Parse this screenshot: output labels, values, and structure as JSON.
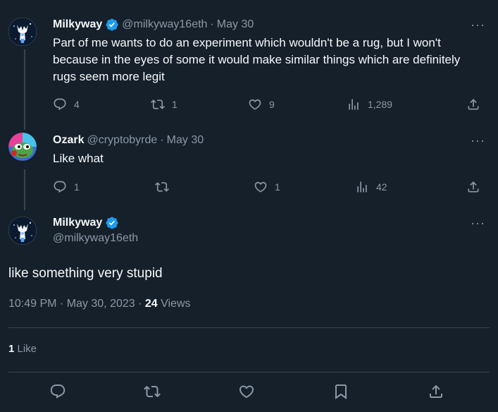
{
  "tweets": [
    {
      "name": "Milkyway",
      "handle": "@milkyway16eth",
      "sep": "·",
      "date": "May 30",
      "text": "Part of me wants to do an experiment which wouldn't be a rug, but I won't because in the eyes of some it would make similar things which are definitely rugs seem more legit",
      "replies": "4",
      "retweets": "1",
      "likes": "9",
      "views": "1,289"
    },
    {
      "name": "Ozark",
      "handle": "@cryptobyrde",
      "sep": "·",
      "date": "May 30",
      "text": "Like what",
      "replies": "1",
      "retweets": "",
      "likes": "1",
      "views": "42"
    }
  ],
  "main": {
    "name": "Milkyway",
    "handle": "@milkyway16eth",
    "text": "like something very stupid",
    "timestamp": "10:49 PM · May 30, 2023 · ",
    "views_count": "24",
    "views_label": " Views",
    "likes_count": "1",
    "likes_label": " Like"
  },
  "icons": {
    "more": "more-icon",
    "verified": "verified-badge-icon",
    "reply": "reply-icon",
    "retweet": "retweet-icon",
    "like": "heart-icon",
    "views": "analytics-icon",
    "share": "share-icon",
    "bookmark": "bookmark-icon"
  },
  "colors": {
    "background": "#15202b",
    "text": "#f7f9f9",
    "secondary": "#8b98a5",
    "verified": "#1d9bf0",
    "border": "#38444d"
  }
}
